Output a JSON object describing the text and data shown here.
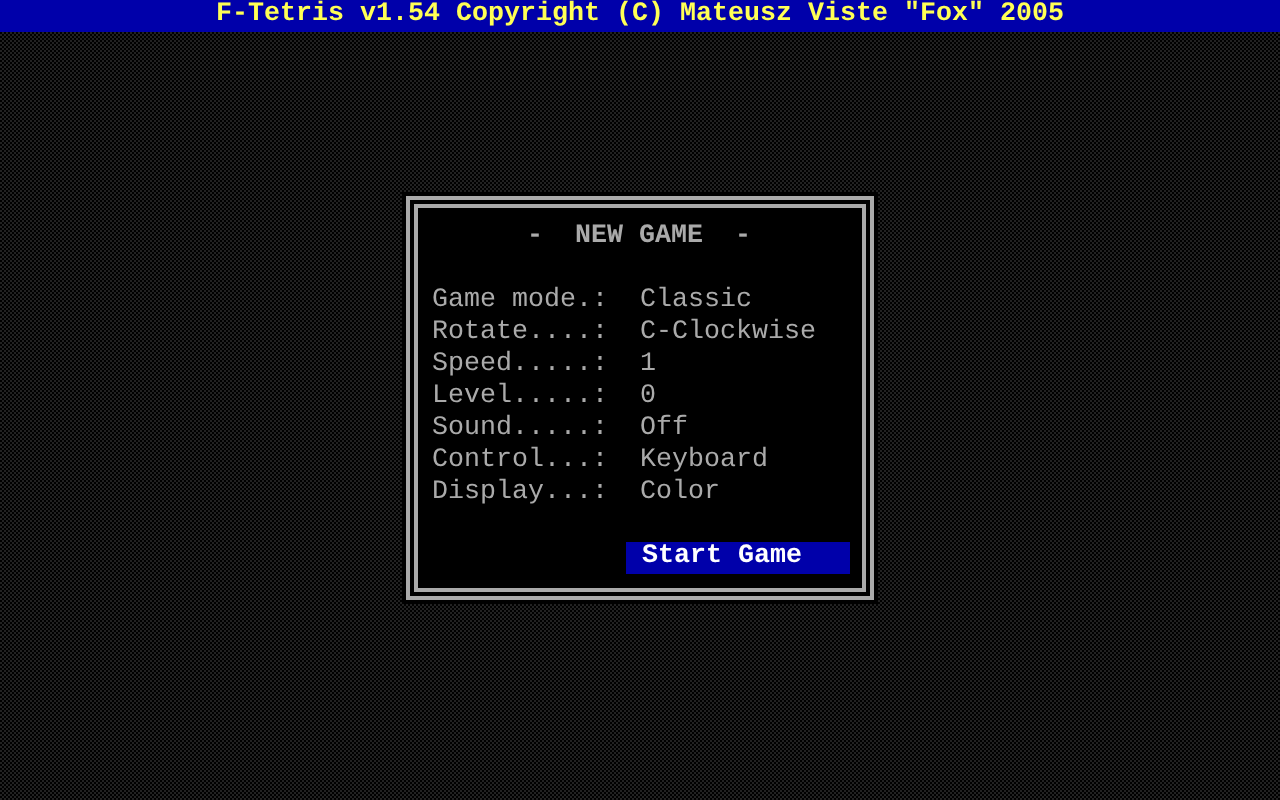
{
  "title_bar": {
    "title": "F-Tetris v1.54 Copyright (C) Mateusz Viste \"Fox\" 2005"
  },
  "dialog": {
    "title": "-  NEW GAME  -",
    "options": [
      {
        "label": "Game mode.:",
        "value": "Classic",
        "selected": false
      },
      {
        "label": "Rotate....:",
        "value": "C-Clockwise",
        "selected": false
      },
      {
        "label": "Speed.....:",
        "value": "1",
        "selected": false
      },
      {
        "label": "Level.....:",
        "value": "0",
        "selected": false
      },
      {
        "label": "Sound.....:",
        "value": "Off",
        "selected": false
      },
      {
        "label": "Control...:",
        "value": "Keyboard",
        "selected": false
      },
      {
        "label": "Display...:",
        "value": "Color",
        "selected": false
      }
    ],
    "start_button": {
      "label": "Start Game",
      "selected": true
    }
  }
}
